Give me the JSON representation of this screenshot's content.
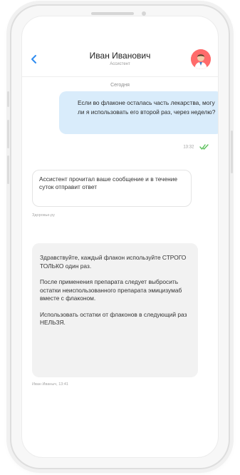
{
  "header": {
    "name": "Иван Иванович",
    "role": "Ассистент"
  },
  "date_separator": "Сегодня",
  "messages": {
    "outgoing": {
      "text": "Если во флаконе осталась часть лекарства, могу ли я использовать его второй раз, через неделю?",
      "time": "13:32"
    },
    "system": {
      "text": "Ассистент прочитал ваше сообщение и в течение суток отправит ответ",
      "sender": "Здоровье.ру"
    },
    "incoming": {
      "paragraphs": [
        "Здравствуйте, каждый флакон используйте СТРОГО ТОЛЬКО один раз.",
        "После применения препарата следует выбросить остатки неиспользованного препарата эмицизумаб вместе с флаконом.",
        "Использовать остатки от флаконов в следующий раз НЕЛЬЗЯ."
      ],
      "meta": "Иван Иваныч, 13:41"
    }
  },
  "icons": {
    "back": "chevron-left-icon",
    "read": "double-check-icon",
    "avatar": "doctor-avatar"
  },
  "colors": {
    "accent": "#2f8cf0",
    "outgoing_bubble": "#d9ecfb",
    "incoming_bubble": "#f2f2f2",
    "read_check": "#5cc15c",
    "avatar_bg": "#ff6b6b"
  }
}
